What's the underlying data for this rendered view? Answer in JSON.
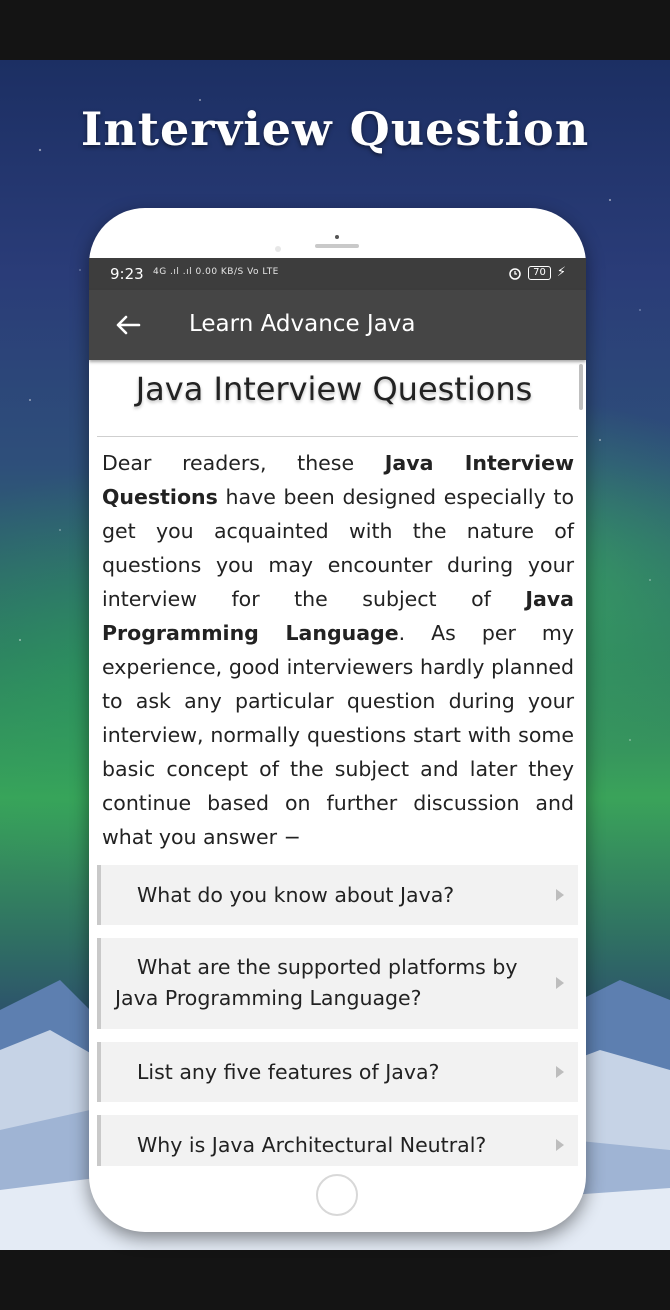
{
  "promo": {
    "headline": "Interview Question"
  },
  "status_bar": {
    "time": "9:23",
    "network": "4G .ıl .ıl 0.00 KB/S Vo LTE",
    "battery": "70"
  },
  "app_bar": {
    "back_icon": "arrow-left",
    "title": "Learn Advance Java"
  },
  "page": {
    "heading": "Java Interview Questions",
    "intro": {
      "p1": "Dear readers, these ",
      "b1": "Java Interview Questions",
      "p2": " have been designed especially to get you acquainted with the nature of questions you may encounter during your interview for the subject of ",
      "b2": "Java Programming Language",
      "p3": ". As per my experience, good interviewers hardly planned to ask any particular question during your interview, normally questions start with some basic concept of the subject and later they continue based on further discussion and what you answer −"
    },
    "questions": [
      {
        "label": "What do you know about Java?"
      },
      {
        "label_line1": "What are the supported platforms by",
        "label_line2": "Java Programming Language?"
      },
      {
        "label": "List any five features of Java?"
      },
      {
        "label": "Why is Java Architectural Neutral?"
      }
    ]
  },
  "colors": {
    "app_bar": "#454545",
    "status_bar": "#3d3d3d",
    "item_background": "#f2f2f2"
  }
}
